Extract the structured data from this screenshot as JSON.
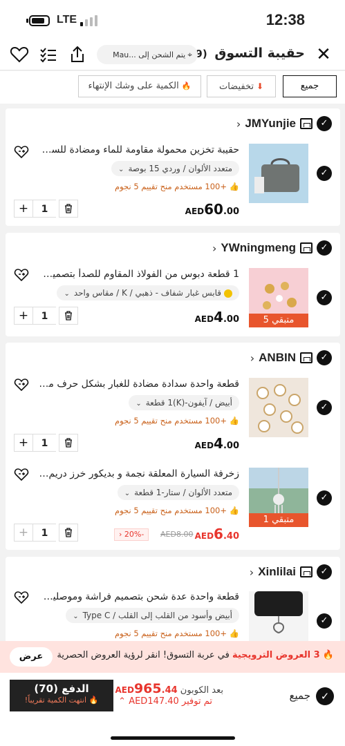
{
  "status_bar": {
    "time": "12:38",
    "network": "LTE"
  },
  "header": {
    "title": "حقيبة التسوق",
    "count": "(59)",
    "shipping": "يتم الشحن إلى ...Mau"
  },
  "filters": {
    "all": "جميع",
    "discounts": "تخفيضات",
    "low_stock": "الكمية على وشك الإنتهاء"
  },
  "stores": [
    {
      "name": "JMYunjie",
      "items": [
        {
          "name": "حقيبة تخزين محمولة مقاومة للماء ومضادة للسقوط...",
          "variant": "متعدد الألوان / وردي 15 بوصة",
          "rating": "+100 مستخدم منح تقييم 5 نجوم",
          "price": {
            "currency": "AED",
            "whole": "60",
            "fraction": ".00"
          },
          "qty": "1"
        }
      ]
    },
    {
      "name": "YWningmeng",
      "items": [
        {
          "name": "1 قطعة دبوس من الفولاذ المقاوم للصدأ بتصميم بسيط",
          "variant": "قابس غبار شفاف - ذهبي / K / مقاس واحد",
          "stock": "متبقي 5",
          "price": {
            "currency": "AED",
            "whole": "4",
            "fraction": ".00"
          },
          "qty": "1"
        }
      ]
    },
    {
      "name": "ANBIN",
      "items": [
        {
          "name": "قطعة واحدة سدادة مضادة للغبار بشكل حرف متوافقة",
          "variant": "أبيض / آيفون-(K)1 قطعة",
          "rating": "+100 مستخدم منح تقييم 5 نجوم",
          "price": {
            "currency": "AED",
            "whole": "4",
            "fraction": ".00"
          },
          "qty": "1"
        },
        {
          "name": "زخرفة السيارة المعلقة نجمة و بديكور خرز دريم كاتشر",
          "variant": "متعدد الألوان / ستار-1 قطعة",
          "rating": "+100 مستخدم منح تقييم 5 نجوم",
          "stock": "متبقي 1",
          "price": {
            "currency": "AED",
            "whole": "6",
            "fraction": ".40"
          },
          "old_price": "AED8.00",
          "discount": "-20%",
          "qty": "1"
        }
      ]
    },
    {
      "name": "Xinlilai",
      "items": [
        {
          "name": "قطعة واحدة عدة شحن بتصميم فراشة وموصلين يتوافق",
          "variant": "أبيض وأسود من القلب إلى القلب / Type C",
          "rating": "+100 مستخدم منح تقييم 5 نجوم"
        }
      ]
    }
  ],
  "promo": {
    "highlight": "3 العروض الترويجية",
    "text": "في عربة التسوق! انقر لرؤية العروض الحصرية",
    "button": "عرض"
  },
  "bottom_bar": {
    "select_all": "جميع",
    "after_coupon_label": "بعد الكوبون",
    "total": {
      "currency": "AED",
      "whole": "965",
      "fraction": ".44"
    },
    "saved": "تم توفير AED147.40",
    "pay_label": "الدفع (70)",
    "pay_sub": "انتهت الكمية تقريباً!"
  },
  "colors": {
    "accent": "#e8352d",
    "stock_badge": "#e8552d",
    "promo_bg": "#ffe3df",
    "rating": "#c9611a"
  }
}
